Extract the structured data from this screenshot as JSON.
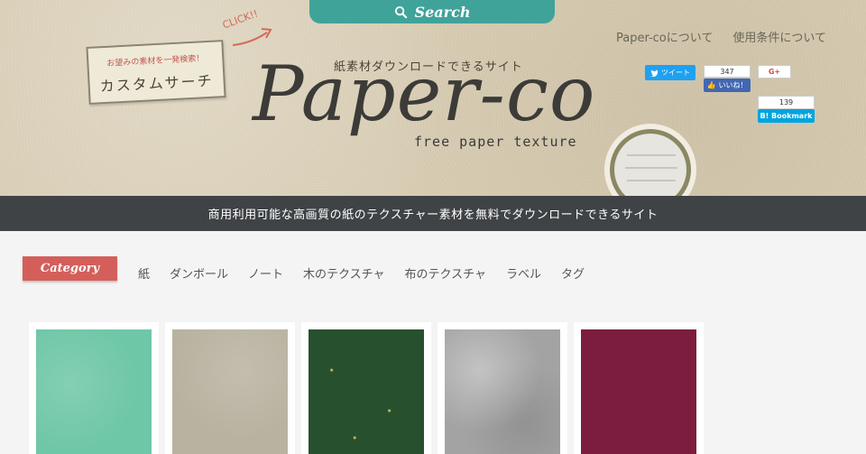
{
  "header": {
    "search_label": "Search",
    "nav": [
      "Paper-coについて",
      "使用条件について"
    ],
    "custom_search": {
      "small": "お望みの素材を一発検索！",
      "big": "カスタムサーチ"
    },
    "click_label": "CLICK!!",
    "tagline": "紙素材ダウンロードできるサイト",
    "logo": "Paper-co",
    "logo_sub": "free paper texture"
  },
  "share": {
    "tweet_label": "ツイート",
    "fb_count": "347",
    "fb_label": "いいね！",
    "gplus_label": "G+",
    "hatena_count": "139",
    "hatena_label": "B! Bookmark"
  },
  "banner": "商用利用可能な高画質の紙のテクスチャー素材を無料でダウンロードできるサイト",
  "category": {
    "label": "Category",
    "items": [
      "紙",
      "ダンボール",
      "ノート",
      "木のテクスチャ",
      "布のテクスチャ",
      "ラベル",
      "タグ"
    ]
  },
  "colors": {
    "accent_teal": "#3fa39a",
    "accent_red": "#d45f5a",
    "banner_dark": "#3f4346",
    "swatches": [
      "#6ec7a6",
      "#b8b2a0",
      "#27512e",
      "#a3a3a3",
      "#7c1d3f"
    ]
  }
}
